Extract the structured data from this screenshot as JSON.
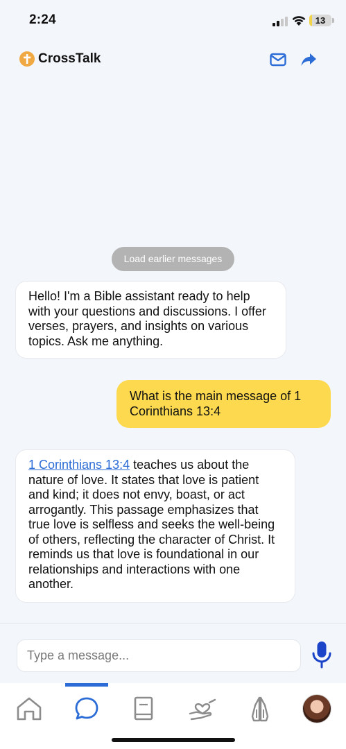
{
  "status_bar": {
    "time": "2:24",
    "battery": "13",
    "battery_level": 0.13
  },
  "header": {
    "title": "CrossTalk",
    "icons": [
      "cross-logo-icon",
      "mail-icon",
      "share-icon"
    ],
    "accent_color": "#2b6cd6"
  },
  "chat": {
    "load_earlier_label": "Load earlier messages",
    "messages": [
      {
        "sender": "assistant",
        "text": "Hello! I'm a Bible assistant ready to help with your questions and discussions. I offer verses, prayers, and insights on various topics. Ask me anything."
      },
      {
        "sender": "user",
        "text": "What is the main message of 1 Corinthians 13:4"
      },
      {
        "sender": "assistant",
        "link_text": "1 Corinthians 13:4",
        "text": " teaches us about the nature of love. It states that love is patient and kind; it does not envy, boast, or act arrogantly. This passage emphasizes that true love is selfless and seeks the well-being of others, reflecting the character of Christ. It reminds us that love is foundational in our relationships and interactions with one another."
      }
    ]
  },
  "composer": {
    "placeholder": "Type a message...",
    "value": "",
    "mic_icon": "microphone-icon"
  },
  "tab_bar": {
    "active_tab": "chat",
    "tabs": [
      "home-icon",
      "chat-icon",
      "bible-icon",
      "prayer-hands-heart-icon",
      "praying-hands-icon",
      "profile-avatar"
    ]
  },
  "colors": {
    "user_bubble": "#fcd94f",
    "bot_bubble": "#ffffff",
    "background": "#f3f6fb",
    "link": "#2b6cd6"
  }
}
